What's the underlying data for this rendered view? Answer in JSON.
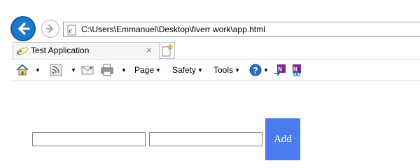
{
  "browser": {
    "address": "C:\\Users\\Emmanuel\\Desktop\\fiverr work\\app.html",
    "tab_title": "Test Application",
    "tab_close": "×"
  },
  "commandbar": {
    "page_label": "Page",
    "safety_label": "Safety",
    "tools_label": "Tools",
    "dropdown_glyph": "▼"
  },
  "form": {
    "input1_value": "",
    "input2_value": "",
    "add_label": "Add"
  },
  "colors": {
    "accent": "#1e78c8",
    "add_button": "#4a7cf0"
  }
}
